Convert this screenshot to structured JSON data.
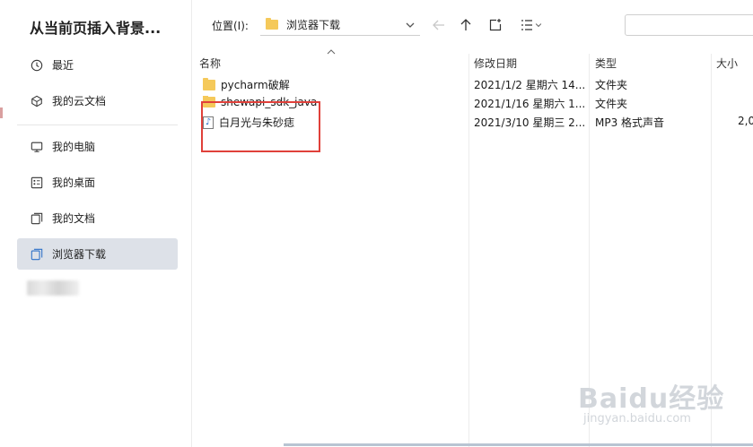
{
  "dialog": {
    "title": "从当前页插入背景..."
  },
  "sidebar": {
    "items": [
      {
        "label": "最近",
        "icon": "clock-icon"
      },
      {
        "label": "我的云文档",
        "icon": "cloud-doc-icon"
      },
      {
        "label": "我的电脑",
        "icon": "computer-icon"
      },
      {
        "label": "我的桌面",
        "icon": "desktop-icon"
      },
      {
        "label": "我的文档",
        "icon": "documents-icon"
      },
      {
        "label": "浏览器下载",
        "icon": "download-folder-icon",
        "active": true
      }
    ]
  },
  "toolbar": {
    "location_label": "位置(I):",
    "location_value": "浏览器下载",
    "search_placeholder": ""
  },
  "filelist": {
    "columns": {
      "name": "名称",
      "date": "修改日期",
      "type": "类型",
      "size": "大小"
    },
    "rows": [
      {
        "name": "pycharm破解",
        "date": "2021/1/2 星期六 14...",
        "type": "文件夹",
        "size": "",
        "kind": "folder"
      },
      {
        "name": "shewapi_sdk_java",
        "date": "2021/1/16 星期六 1...",
        "type": "文件夹",
        "size": "",
        "kind": "folder"
      },
      {
        "name": "白月光与朱砂痣",
        "date": "2021/3/10 星期三 2...",
        "type": "MP3 格式声音",
        "size": "2,0",
        "kind": "mp3"
      }
    ]
  },
  "watermark": {
    "main": "Baidu经验",
    "sub": "jingyan.baidu.com"
  },
  "colors": {
    "highlight_box": "#e0403a",
    "active_nav": "#dde1e8",
    "folder": "#f5c95a"
  }
}
